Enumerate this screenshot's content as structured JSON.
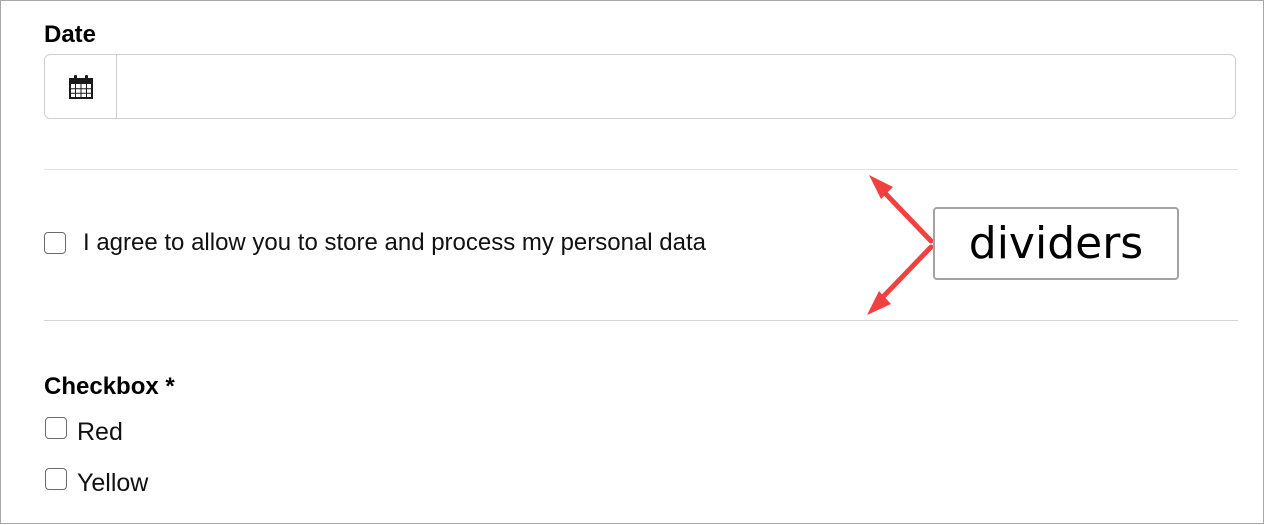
{
  "form": {
    "date": {
      "label": "Date",
      "value": "",
      "icon": "calendar-icon"
    },
    "consent": {
      "label": "I agree to allow you to store and process my personal data",
      "checked": false
    },
    "checkbox_group": {
      "label": "Checkbox *",
      "options": [
        {
          "label": "Red",
          "checked": false
        },
        {
          "label": "Yellow",
          "checked": false
        }
      ]
    }
  },
  "annotation": {
    "text": "dividers",
    "arrow_color": "#f04040"
  }
}
